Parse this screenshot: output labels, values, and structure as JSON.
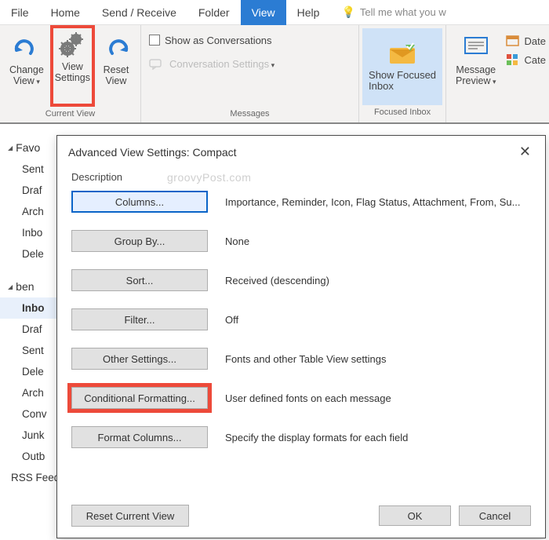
{
  "menu": {
    "items": [
      "File",
      "Home",
      "Send / Receive",
      "Folder",
      "View",
      "Help"
    ],
    "active_index": 4,
    "tell_me": "Tell me what you w"
  },
  "ribbon": {
    "current_view": {
      "label": "Current View",
      "change_view": "Change\nView",
      "view_settings": "View\nSettings",
      "reset_view": "Reset\nView"
    },
    "messages": {
      "label": "Messages",
      "show_conversations": "Show as Conversations",
      "conversation_settings": "Conversation Settings"
    },
    "focused": {
      "label": "Focused Inbox",
      "button": "Show Focused\nInbox"
    },
    "arrangement": {
      "message_preview": "Message\nPreview",
      "date": "Date",
      "cate": "Cate"
    }
  },
  "nav": {
    "favorites": "Favo",
    "items1": [
      "Sent",
      "Draf",
      "Arch",
      "Inbo",
      "Dele"
    ],
    "account": "ben",
    "items2": [
      "Inbo",
      "Draf",
      "Sent",
      "Dele",
      "Arch",
      "Conv",
      "Junk",
      "Outb",
      "RSS Feeds"
    ]
  },
  "dialog": {
    "title": "Advanced View Settings: Compact",
    "description_label": "Description",
    "watermark": "groovyPost.com",
    "rows": [
      {
        "btn": "Columns...",
        "desc": "Importance, Reminder, Icon, Flag Status, Attachment, From, Su..."
      },
      {
        "btn": "Group By...",
        "desc": "None"
      },
      {
        "btn": "Sort...",
        "desc": "Received (descending)"
      },
      {
        "btn": "Filter...",
        "desc": "Off"
      },
      {
        "btn": "Other Settings...",
        "desc": "Fonts and other Table View settings"
      },
      {
        "btn": "Conditional Formatting...",
        "desc": "User defined fonts on each message"
      },
      {
        "btn": "Format Columns...",
        "desc": "Specify the display formats for each field"
      }
    ],
    "reset": "Reset Current View",
    "ok": "OK",
    "cancel": "Cancel"
  }
}
